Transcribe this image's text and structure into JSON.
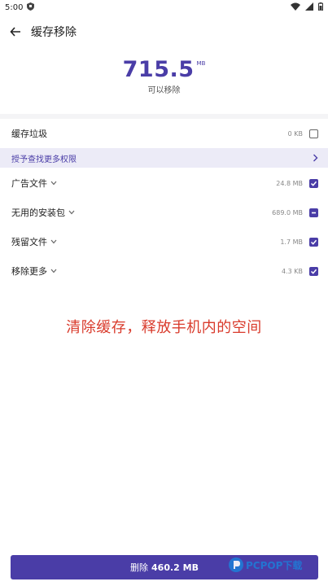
{
  "status": {
    "time": "5:00"
  },
  "appbar": {
    "title": "缓存移除"
  },
  "summary": {
    "value": "715.5",
    "unit": "MB",
    "subtitle": "可以移除"
  },
  "rows": [
    {
      "label": "缓存垃圾",
      "size": "0 KB",
      "checked": "off"
    },
    {
      "label": "广告文件",
      "size": "24.8 MB",
      "checked": "on"
    },
    {
      "label": "无用的安装包",
      "size": "689.0 MB",
      "checked": "partial"
    },
    {
      "label": "残留文件",
      "size": "1.7 MB",
      "checked": "on"
    },
    {
      "label": "移除更多",
      "size": "4.3 KB",
      "checked": "on"
    }
  ],
  "permission": {
    "text": "授予查找更多权限"
  },
  "caption": "清除缓存，释放手机内的空间",
  "cta": {
    "label": "删除",
    "amount": "460.2 MB"
  },
  "watermark": {
    "text": "PCPOP下载"
  },
  "colors": {
    "accent": "#4a3da7",
    "caption": "#d93a2b"
  }
}
